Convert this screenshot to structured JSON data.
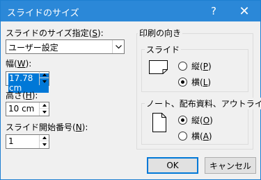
{
  "window": {
    "title": "スライドのサイズ",
    "help_label": "?",
    "close_label": "✕"
  },
  "slide_size": {
    "label": "スライドのサイズ指定(",
    "accel": "S",
    "label_end": "):",
    "selected": "ユーザー設定"
  },
  "width": {
    "label": "幅(",
    "accel": "W",
    "label_end": "):",
    "value": "17.78 cm"
  },
  "height": {
    "label": "高さ(",
    "accel": "H",
    "label_end": "):",
    "value": "10 cm"
  },
  "start_number": {
    "label": "スライド開始番号(",
    "accel": "N",
    "label_end": "):",
    "value": "1"
  },
  "orientation": {
    "title": "印刷の向き",
    "slides": {
      "title": "スライド",
      "portrait_label": "縦(",
      "portrait_accel": "P",
      "portrait_end": ")",
      "landscape_label": "横(",
      "landscape_accel": "L",
      "landscape_end": ")",
      "selected": "landscape"
    },
    "notes": {
      "title": "ノート、配布資料、アウトライン",
      "portrait_label": "縦(",
      "portrait_accel": "O",
      "portrait_end": ")",
      "landscape_label": "横(",
      "landscape_accel": "A",
      "landscape_end": ")",
      "selected": "portrait"
    }
  },
  "buttons": {
    "ok": "OK",
    "cancel": "キャンセル"
  }
}
